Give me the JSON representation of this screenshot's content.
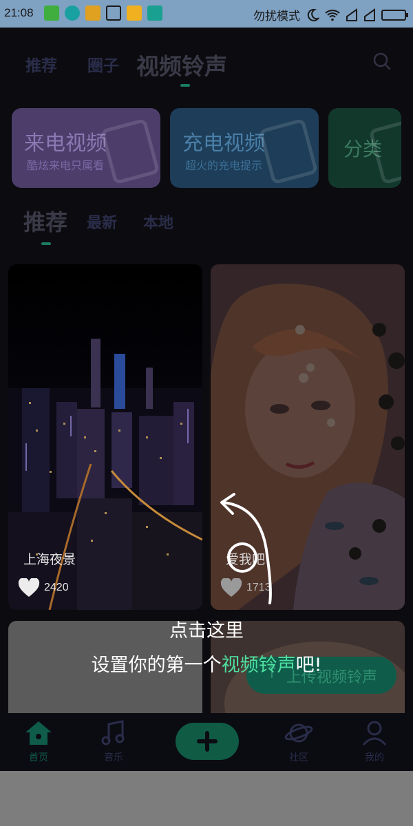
{
  "status_bar": {
    "time": "21:08",
    "dnd": "勿扰模式",
    "icons": [
      "android-icon",
      "sync-icon",
      "warning-icon",
      "broom-icon",
      "folder-icon",
      "usb-icon",
      "moon-icon",
      "wifi-icon",
      "signal-icon",
      "signal-icon",
      "battery-icon"
    ]
  },
  "top_nav": {
    "tabs": [
      {
        "label": "推荐"
      },
      {
        "label": "圈子"
      },
      {
        "label": "视频铃声"
      }
    ],
    "search_icon": "search-icon"
  },
  "categories": [
    {
      "title": "来电视频",
      "subtitle": "酷炫来电只属看",
      "color": "#4c3d6b"
    },
    {
      "title": "充电视频",
      "subtitle": "超火的充电提示",
      "color": "#1d3d58"
    },
    {
      "title": "分类",
      "subtitle": "",
      "color": "#12382c"
    }
  ],
  "sub_tabs": [
    {
      "label": "推荐"
    },
    {
      "label": "最新"
    },
    {
      "label": "本地"
    }
  ],
  "videos": [
    {
      "title": "上海夜景",
      "likes": "2420"
    },
    {
      "title": "爱我吧",
      "likes": "1713"
    },
    {
      "title": "",
      "likes": ""
    },
    {
      "title": "",
      "likes": ""
    }
  ],
  "upload_button": "上传视频铃声",
  "guide": {
    "line1": "点击这里",
    "line2_prefix": "设置你的第一个",
    "line2_highlight": "视频铃声",
    "line2_suffix": "吧!",
    "highlight_color": "#4ee0a0"
  },
  "tab_bar": {
    "items": [
      {
        "label": "首页",
        "icon": "home-icon"
      },
      {
        "label": "音乐",
        "icon": "music-icon"
      },
      {
        "label": "",
        "icon": "plus-icon"
      },
      {
        "label": "社区",
        "icon": "planet-icon"
      },
      {
        "label": "我的",
        "icon": "user-icon"
      }
    ]
  }
}
